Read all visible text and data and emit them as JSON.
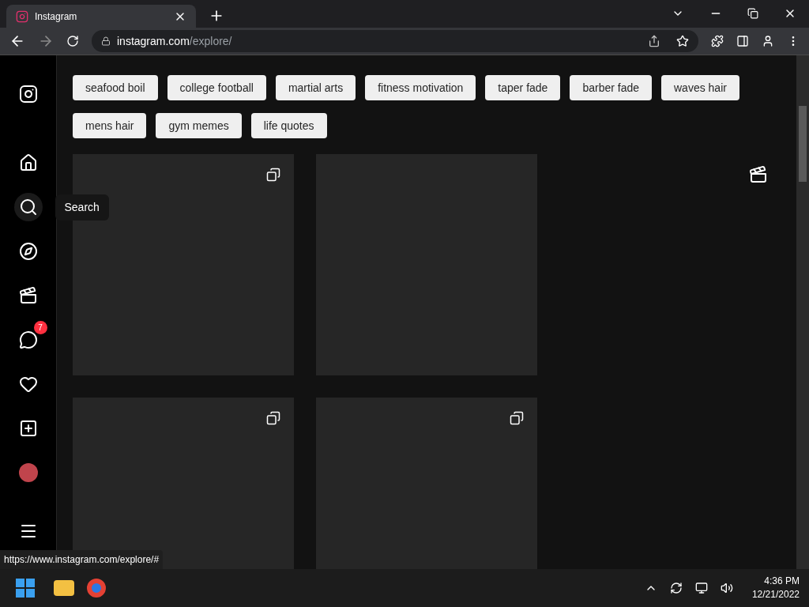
{
  "browser": {
    "tab_title": "Instagram",
    "url_host": "instagram.com",
    "url_path": "/explore/"
  },
  "sidebar": {
    "items": [
      {
        "kind": "home",
        "hovered": false
      },
      {
        "kind": "search",
        "hovered": true,
        "tooltip": "Search"
      },
      {
        "kind": "explore",
        "hovered": false
      },
      {
        "kind": "reels",
        "hovered": false
      },
      {
        "kind": "messages",
        "hovered": false,
        "badge": "7"
      },
      {
        "kind": "notifications",
        "hovered": false
      },
      {
        "kind": "create",
        "hovered": false
      },
      {
        "kind": "profile",
        "hovered": false
      }
    ]
  },
  "tags": [
    [
      "seafood boil",
      "college football",
      "martial arts",
      "fitness motivation",
      "taper fade",
      "barber fade",
      "waves hair"
    ],
    [
      "mens hair",
      "gym memes",
      "life quotes"
    ]
  ],
  "posts": [
    [
      {
        "kind": "carousel"
      },
      {
        "kind": "plain"
      },
      {
        "kind": "reel"
      }
    ],
    [
      {
        "kind": "carousel"
      },
      {
        "kind": "carousel"
      }
    ]
  ],
  "status_url": "https://www.instagram.com/explore/#",
  "taskbar": {
    "time": "4:36 PM",
    "date": "12/21/2022"
  }
}
